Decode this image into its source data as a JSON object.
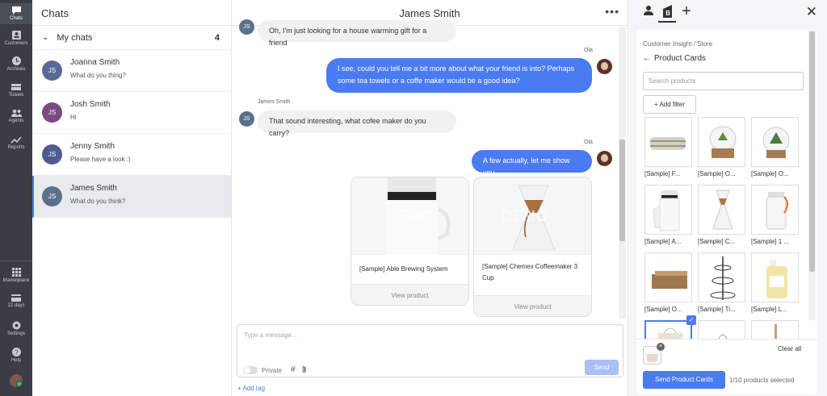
{
  "rail": {
    "items": [
      {
        "label": "Chats",
        "icon": "chat-icon"
      },
      {
        "label": "Customers",
        "icon": "customers-icon"
      },
      {
        "label": "Archives",
        "icon": "clock-icon"
      },
      {
        "label": "Tickets",
        "icon": "ticket-icon"
      },
      {
        "label": "Agents",
        "icon": "agents-icon"
      },
      {
        "label": "Reports",
        "icon": "chart-icon"
      }
    ],
    "bottom_items": [
      {
        "label": "Marketplace",
        "icon": "grid-icon"
      },
      {
        "label": "22 days",
        "icon": "card-icon"
      },
      {
        "label": "Settings",
        "icon": "gear-icon"
      },
      {
        "label": "Help",
        "icon": "help-icon"
      }
    ]
  },
  "chat_list": {
    "title": "Chats",
    "section_label": "My chats",
    "section_count": "4",
    "chats": [
      {
        "initials": "JS",
        "name": "Joanna Smith",
        "message": "What do you thing?",
        "color": "#5a6896"
      },
      {
        "initials": "JS",
        "name": "Josh Smith",
        "message": "Hi",
        "color": "#7a4a80"
      },
      {
        "initials": "JS",
        "name": "Jenny Smith",
        "message": "Please have a look :)",
        "color": "#4e5c90"
      },
      {
        "initials": "JS",
        "name": "James Smith",
        "message": "What do you think?",
        "color": "#5a7189"
      }
    ]
  },
  "conversation": {
    "title": "James Smith",
    "more_icon": "more-dots-icon",
    "messages": {
      "m1": "Oh, I'm just looking for a house warming gift for a friend",
      "m2_sender": "Ola",
      "m2": "I see, could you tell me a bit more about what your friend is into? Perhaps some tea towels or a coffe maker would be a good idea?",
      "m3_sender": "James Smith",
      "m3": "That sound interesting, what cofee maker do you carry?",
      "m4_sender": "Ola",
      "m4": "A few actually, let me show you"
    },
    "cav_initials": "JS",
    "cards": [
      {
        "title": "[Sample] Able Brewing System",
        "action": "View product",
        "demo": "DEMO"
      },
      {
        "title": "[Sample] Chemex Coffeemaker 3 Cup",
        "action": "View product",
        "demo": "DEMO"
      }
    ],
    "composer": {
      "placeholder": "Type a message...",
      "private_label": "Private",
      "hash": "#",
      "send_label": "Send",
      "add_tag": "+ Add tag"
    }
  },
  "panel": {
    "breadcrumb": "Customer Insight  /  Store",
    "title": "Product Cards",
    "search_placeholder": "Search products",
    "add_filter": "+ Add filter",
    "products": [
      "[Sample] F...",
      "[Sample] O...",
      "[Sample] O...",
      "[Sample] A...",
      "[Sample] C...",
      "[Sample] 1 ...",
      "[Sample] O...",
      "[Sample] Ti...",
      "[Sample] L..."
    ],
    "clear_all": "Clear all",
    "send_cards": "Send Product Cards",
    "selected_count": "1/10 products selected"
  }
}
